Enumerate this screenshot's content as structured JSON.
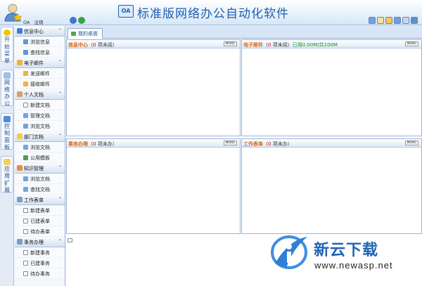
{
  "header": {
    "logo_text": "OA",
    "title": "标准版网络办公自动化软件",
    "user_prefix": "OA",
    "logout_label": "注销"
  },
  "side_tabs": [
    {
      "label": "开始菜单",
      "icon": "bulb-icon"
    },
    {
      "label": "网络办公",
      "icon": "mail-icon"
    },
    {
      "label": "控制面板",
      "icon": "control-panel-icon"
    },
    {
      "label": "应用扩展",
      "icon": "star-icon"
    }
  ],
  "nav": {
    "sections": [
      {
        "title": "信息中心",
        "icon": "info-icon",
        "items": [
          "浏览信息",
          "查找信息"
        ]
      },
      {
        "title": "电子邮件",
        "icon": "mail-icon",
        "items": [
          "发送邮件",
          "接收邮件"
        ]
      },
      {
        "title": "个人文档",
        "icon": "user-docs-icon",
        "items": [
          "新建文档",
          "管理文档",
          "浏览文档"
        ]
      },
      {
        "title": "部门文档",
        "icon": "folder-icon",
        "items": [
          "浏览文档",
          "公用模板"
        ]
      },
      {
        "title": "知识管理",
        "icon": "knowledge-icon",
        "items": [
          "浏览文档",
          "查找文档"
        ]
      },
      {
        "title": "工作表单",
        "icon": "form-icon",
        "items": [
          "新建表单",
          "已建表单",
          "待办表单"
        ]
      },
      {
        "title": "事务办理",
        "icon": "task-icon",
        "items": [
          "新建事务",
          "已建事务",
          "待办事务"
        ]
      }
    ]
  },
  "main": {
    "tab_label": "我的桌面",
    "panels": [
      {
        "title": "信息中心",
        "paren_open": "（",
        "count": "0",
        "suffix": " 项未阅）",
        "quota": "",
        "more": "MORE"
      },
      {
        "title": "电子邮件",
        "paren_open": "（",
        "count": "0",
        "suffix": " 项未阅）",
        "quota": "已用0.00M/共100M",
        "more": "MORE"
      },
      {
        "title": "事务办理",
        "paren_open": "（",
        "count": "0",
        "suffix": " 项未办）",
        "quota": "",
        "more": "MORE"
      },
      {
        "title": "工作表单",
        "paren_open": "（",
        "count": "0",
        "suffix": " 项未办）",
        "quota": "",
        "more": "MORE"
      }
    ]
  },
  "watermark": {
    "text": "新云下载",
    "url": "www.newasp.net"
  },
  "colors": {
    "accent": "#1b5fb0",
    "panel_title": "#e0660b",
    "count": "#dd0000",
    "quota": "#1d8d1d"
  }
}
